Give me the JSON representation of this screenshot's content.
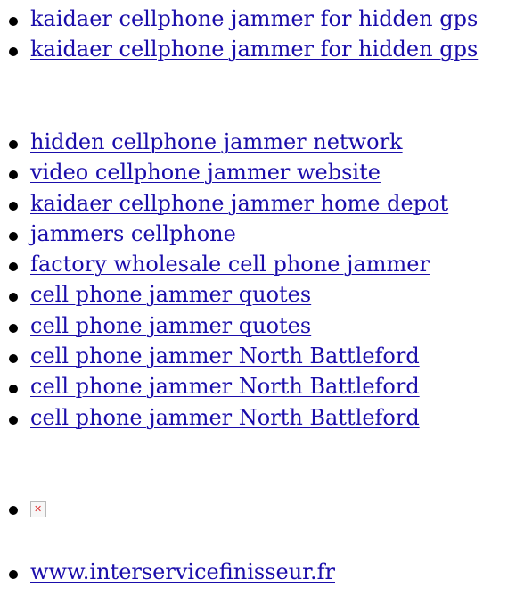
{
  "links_top": [
    "kaidaer cellphone jammer for hidden gps",
    "kaidaer cellphone jammer for hidden gps"
  ],
  "links_middle": [
    "hidden cellphone jammer network",
    "video cellphone jammer website",
    "kaidaer cellphone jammer home depot",
    "jammers cellphone",
    "factory wholesale cell phone jammer",
    "cell phone jammer quotes",
    "cell phone jammer quotes",
    "cell phone jammer North Battleford",
    "cell phone jammer North Battleford",
    "cell phone jammer North Battleford"
  ],
  "image_item": {
    "icon": "broken-image-icon"
  },
  "links_bottom": [
    "www.interservicefinisseur.fr"
  ],
  "colors": {
    "link": "#1a0dab",
    "bullet": "#000000",
    "broken_image_x": "#dd3333"
  }
}
